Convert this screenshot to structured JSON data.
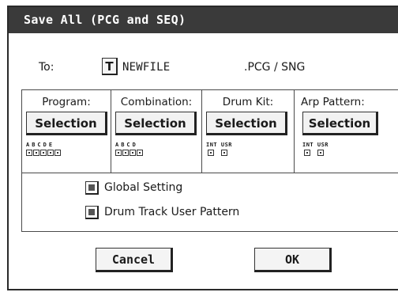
{
  "dialog": {
    "title": "Save All (PCG and SEQ)"
  },
  "to_row": {
    "label": "To:",
    "text_edit_button": "T",
    "filename": "NEWFILE",
    "extension": ".PCG / SNG"
  },
  "columns": [
    {
      "title": "Program:",
      "button": "Selection",
      "bank_letters": "ABCDE",
      "banks": 5
    },
    {
      "title": "Combination:",
      "button": "Selection",
      "bank_letters": "ABCD",
      "banks": 4
    },
    {
      "title": "Drum Kit:",
      "button": "Selection",
      "bank_letters": "INT USR",
      "banks": 2
    },
    {
      "title": "Arp Pattern:",
      "button": "Selection",
      "bank_letters": "INT USR",
      "banks": 2
    }
  ],
  "options": {
    "global_setting": "Global Setting",
    "drum_track_user_pattern": "Drum Track User Pattern"
  },
  "buttons": {
    "cancel": "Cancel",
    "ok": "OK"
  }
}
